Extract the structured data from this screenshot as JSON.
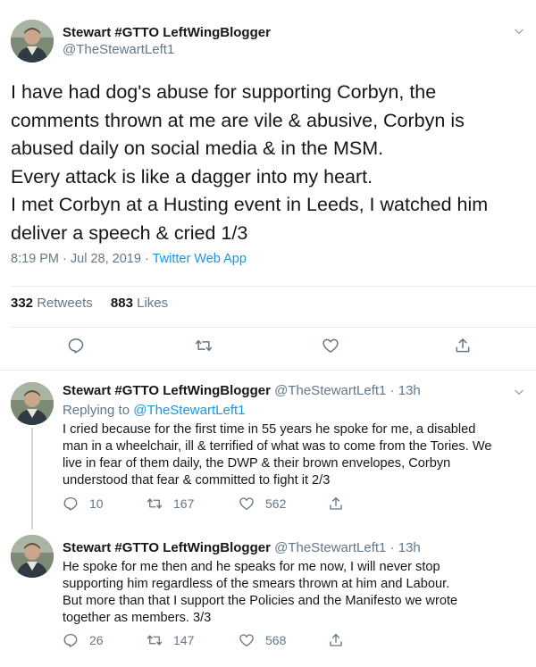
{
  "main_tweet": {
    "author_name": "Stewart #GTTO LeftWingBlogger",
    "author_handle": "@TheStewartLeft1",
    "text": "I have had dog's abuse for supporting Corbyn, the\ncomments thrown at me are vile & abusive, Corbyn is\nabused daily on social media & in the MSM.\nEvery attack is like a dagger into my heart.\nI met Corbyn at a Husting event in Leeds, I watched him\ndeliver a speech & cried 1/3",
    "time": "8:19 PM",
    "separator": "·",
    "date": "Jul 28, 2019",
    "source": "Twitter Web App",
    "retweets_count": "332",
    "retweets_label": "Retweets",
    "likes_count": "883",
    "likes_label": "Likes"
  },
  "replies": [
    {
      "author_name": "Stewart #GTTO LeftWingBlogger",
      "author_handle": "@TheStewartLeft1",
      "age": "· 13h",
      "replying_label": "Replying to",
      "replying_to": "@TheStewartLeft1",
      "text": "I cried because for the first time in 55 years he spoke for me, a disabled\nman in a wheelchair, ill & terrified of what was to come from the Tories. We\nlive in fear of them daily, the DWP & their brown envelopes, Corbyn\nunderstood that fear & committed to fight it 2/3",
      "replies_count": "10",
      "retweets_count": "167",
      "likes_count": "562"
    },
    {
      "author_name": "Stewart #GTTO LeftWingBlogger",
      "author_handle": "@TheStewartLeft1",
      "age": "· 13h",
      "text": "He spoke for me then and he speaks for me now, I will never stop\nsupporting him regardless of the smears thrown at him and Labour.\nBut more than that I support the Policies and the Manifesto we wrote\ntogether as members. 3/3",
      "replies_count": "26",
      "retweets_count": "147",
      "likes_count": "568"
    }
  ],
  "icons": {
    "reply": "reply-icon",
    "retweet": "retweet-icon",
    "like": "heart-icon",
    "share": "share-icon",
    "caret": "chevron-down-icon"
  },
  "colors": {
    "text": "#14171a",
    "secondary": "#657786",
    "link": "#1b95e0",
    "border": "#e6ecf0"
  }
}
